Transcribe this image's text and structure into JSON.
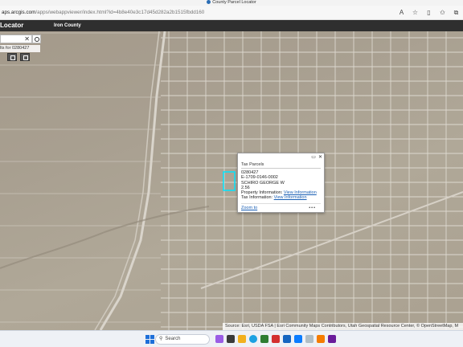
{
  "window": {
    "title": "County Parcel Locator"
  },
  "browser": {
    "url_host": "aps.arcgis.com",
    "url_path": "/apps/webappviewer/index.html?id=4b8e40e3c17d45d282a2b1515fbdd160"
  },
  "app": {
    "name": "Locator",
    "subtitle": "Iron County"
  },
  "search": {
    "clear_glyph": "✕",
    "hint": "lts for 0280427"
  },
  "popup": {
    "title": "Tax Parcels",
    "parcel_id": "0280427",
    "account": "E-1709-0146-0002",
    "owner": "SCHIRO GEORGE W",
    "acres": "2.56",
    "property_label": "Property Information:",
    "property_link": "View Information",
    "tax_label": "Tax Information:",
    "tax_link": "View Information",
    "zoom_label": "Zoom to",
    "more_label": "•••"
  },
  "attribution": "Source: Esri, USDA FSA | Esri Community Maps Contributors, Utah Geospatial Resource Center, © OpenStreetMap, M",
  "taskbar": {
    "search_placeholder": "Search"
  },
  "colors": {
    "app_header": "#2f2f2f",
    "parcel_highlight": "#00e5ff",
    "link": "#1a5fb4"
  },
  "icons": [
    "search-icon",
    "close-icon",
    "maximize-icon",
    "more-icon",
    "windows-start-icon"
  ]
}
